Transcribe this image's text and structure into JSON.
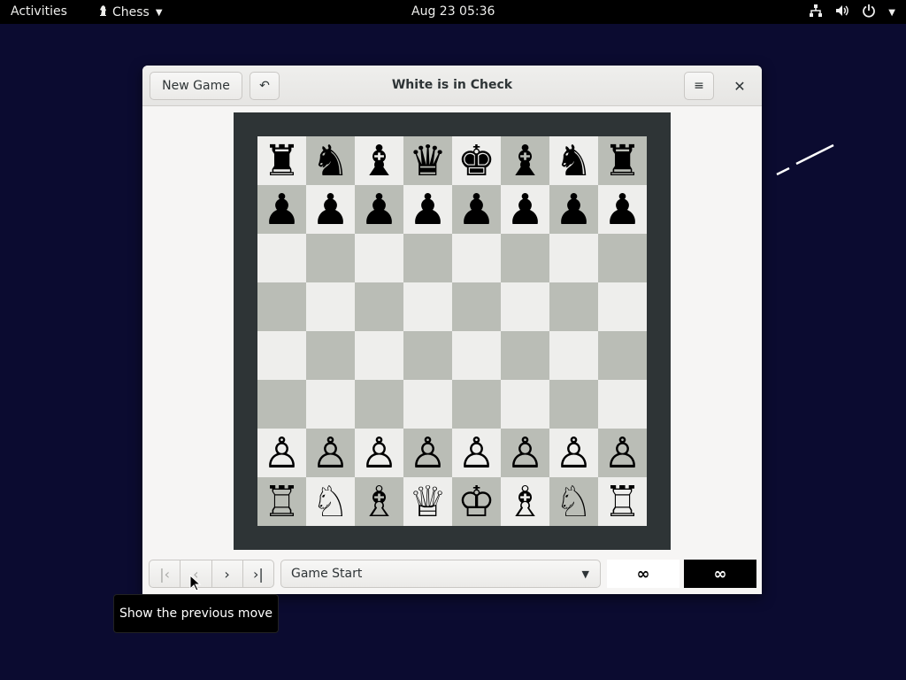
{
  "topbar": {
    "activities": "Activities",
    "app_name": "Chess",
    "clock": "Aug 23  05:36"
  },
  "window": {
    "title": "White is in Check",
    "new_game_label": "New Game",
    "undo_icon": "↶",
    "menu_icon": "≡",
    "close_icon": "✕"
  },
  "board": {
    "ranks": [
      [
        "♜",
        "♞",
        "♝",
        "♛",
        "♚",
        "♝",
        "♞",
        "♜"
      ],
      [
        "♟",
        "♟",
        "♟",
        "♟",
        "♟",
        "♟",
        "♟",
        "♟"
      ],
      [
        "",
        "",
        "",
        "",
        "",
        "",
        "",
        ""
      ],
      [
        "",
        "",
        "",
        "",
        "",
        "",
        "",
        ""
      ],
      [
        "",
        "",
        "",
        "",
        "",
        "",
        "",
        ""
      ],
      [
        "",
        "",
        "",
        "",
        "",
        "",
        "",
        ""
      ],
      [
        "♙",
        "♙",
        "♙",
        "♙",
        "♙",
        "♙",
        "♙",
        "♙"
      ],
      [
        "♖",
        "♘",
        "♗",
        "♕",
        "♔",
        "♗",
        "♘",
        "♖"
      ]
    ]
  },
  "controls": {
    "first_icon": "|‹",
    "prev_icon": "‹",
    "next_icon": "›",
    "last_icon": "›|",
    "history_value": "Game Start",
    "combo_arrow": "▼",
    "white_clock": "∞",
    "black_clock": "∞"
  },
  "tooltip": {
    "text": "Show the previous move"
  },
  "colors": {
    "background": "#0b0b30",
    "light_square": "#eeeeec",
    "dark_square": "#babdb6",
    "board_frame": "#2e3436"
  }
}
